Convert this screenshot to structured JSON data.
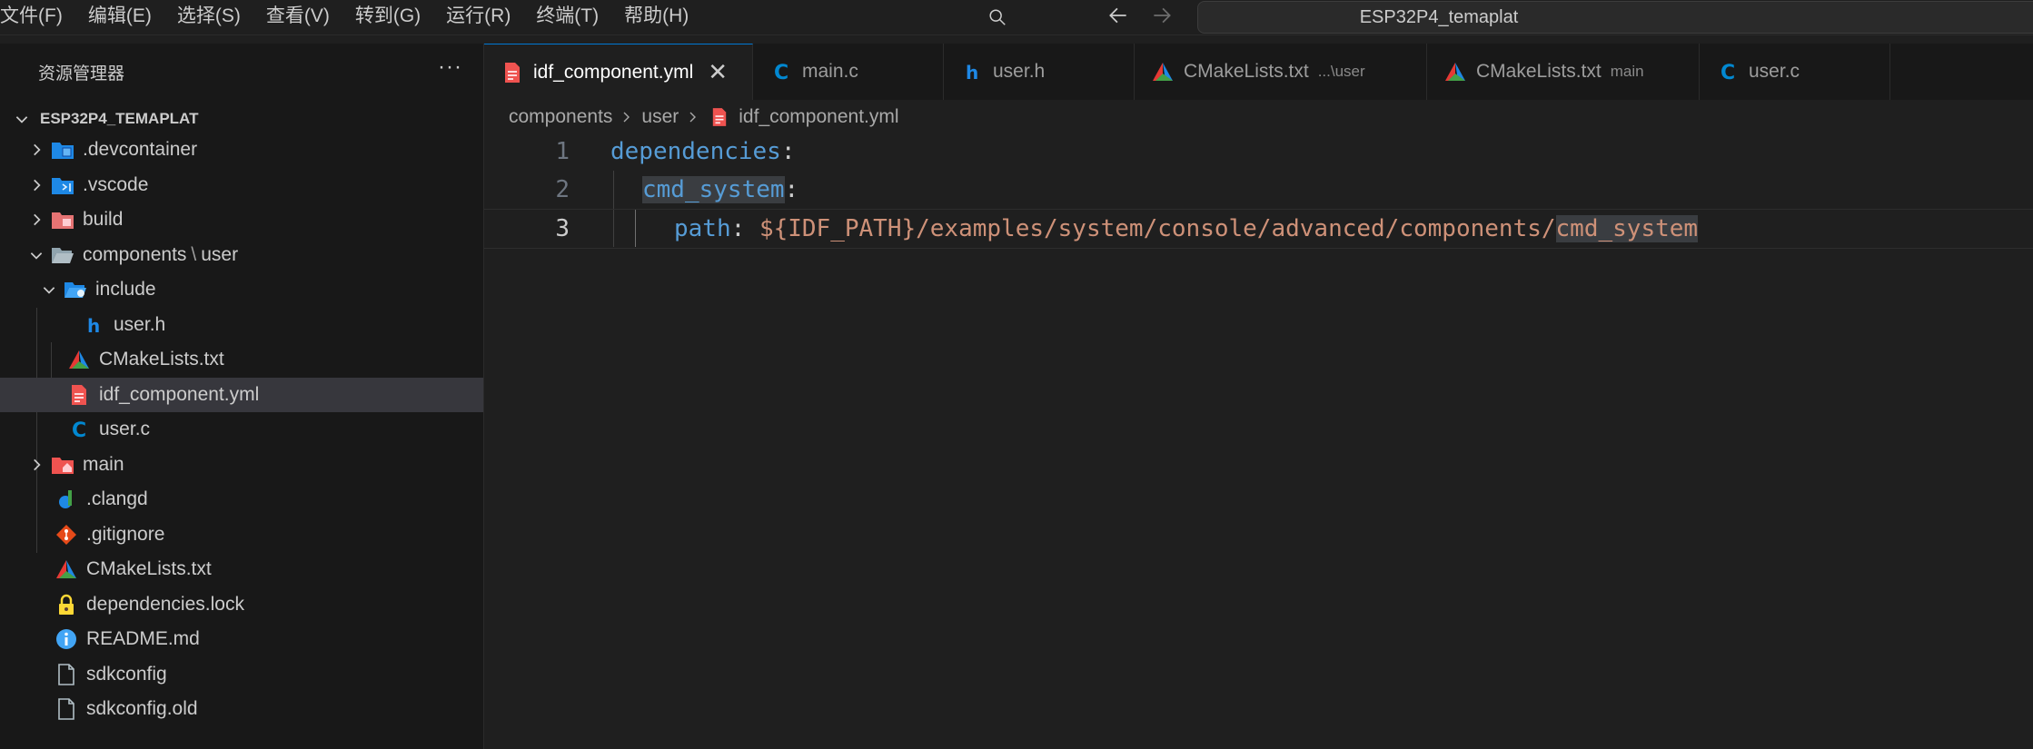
{
  "menu": [
    "文件(F)",
    "编辑(E)",
    "选择(S)",
    "查看(V)",
    "转到(G)",
    "运行(R)",
    "终端(T)",
    "帮助(H)"
  ],
  "command_center": {
    "text": "ESP32P4_temaplat"
  },
  "sidebar": {
    "title": "资源管理器",
    "more": "···",
    "root": "ESP32P4_TEMAPLAT",
    "items": [
      {
        "label": ".devcontainer",
        "icon": "devcontainer-folder-icon"
      },
      {
        "label": ".vscode",
        "icon": "vscode-folder-icon"
      },
      {
        "label": "build",
        "icon": "build-folder-icon"
      },
      {
        "label": "components",
        "label_sep": "\\",
        "label_2": "user",
        "icon": "folder-open-icon"
      },
      {
        "label": "include",
        "icon": "include-folder-icon"
      },
      {
        "label": "user.h",
        "icon": "h-file-icon"
      },
      {
        "label": "CMakeLists.txt",
        "icon": "cmake-icon"
      },
      {
        "label": "idf_component.yml",
        "icon": "yaml-file-icon"
      },
      {
        "label": "user.c",
        "icon": "c-file-icon"
      },
      {
        "label": "main",
        "icon": "main-folder-icon"
      },
      {
        "label": ".clangd",
        "icon": "clangd-icon"
      },
      {
        "label": ".gitignore",
        "icon": "git-icon"
      },
      {
        "label": "CMakeLists.txt",
        "icon": "cmake-icon"
      },
      {
        "label": "dependencies.lock",
        "icon": "lock-icon"
      },
      {
        "label": "README.md",
        "icon": "info-icon"
      },
      {
        "label": "sdkconfig",
        "icon": "file-icon"
      },
      {
        "label": "sdkconfig.old",
        "icon": "file-icon"
      }
    ]
  },
  "tabs": [
    {
      "label": "idf_component.yml",
      "desc": "",
      "icon": "yaml-file-icon",
      "active": true
    },
    {
      "label": "main.c",
      "desc": "",
      "icon": "c-file-icon"
    },
    {
      "label": "user.h",
      "desc": "",
      "icon": "h-file-icon"
    },
    {
      "label": "CMakeLists.txt",
      "desc": "...\\user",
      "icon": "cmake-icon"
    },
    {
      "label": "CMakeLists.txt",
      "desc": "main",
      "icon": "cmake-icon"
    },
    {
      "label": "user.c",
      "desc": "",
      "icon": "c-file-icon"
    }
  ],
  "tab_close": "✕",
  "breadcrumb": [
    "components",
    "user",
    "idf_component.yml"
  ],
  "code": {
    "line_numbers": [
      "1",
      "2",
      "3"
    ],
    "line1_key": "dependencies",
    "line1_colon": ":",
    "line2_key": "cmd_system",
    "line2_colon": ":",
    "line3_key": "path",
    "line3_colon": ": ",
    "line3_value_a": "${IDF_PATH}/examples/system/console/advanced/components/",
    "line3_value_b": "cmd_system"
  },
  "colors": {
    "accent": "#0078d4",
    "keyword": "#569cd6",
    "string": "#ce9178",
    "selection_row": "#37373d"
  }
}
